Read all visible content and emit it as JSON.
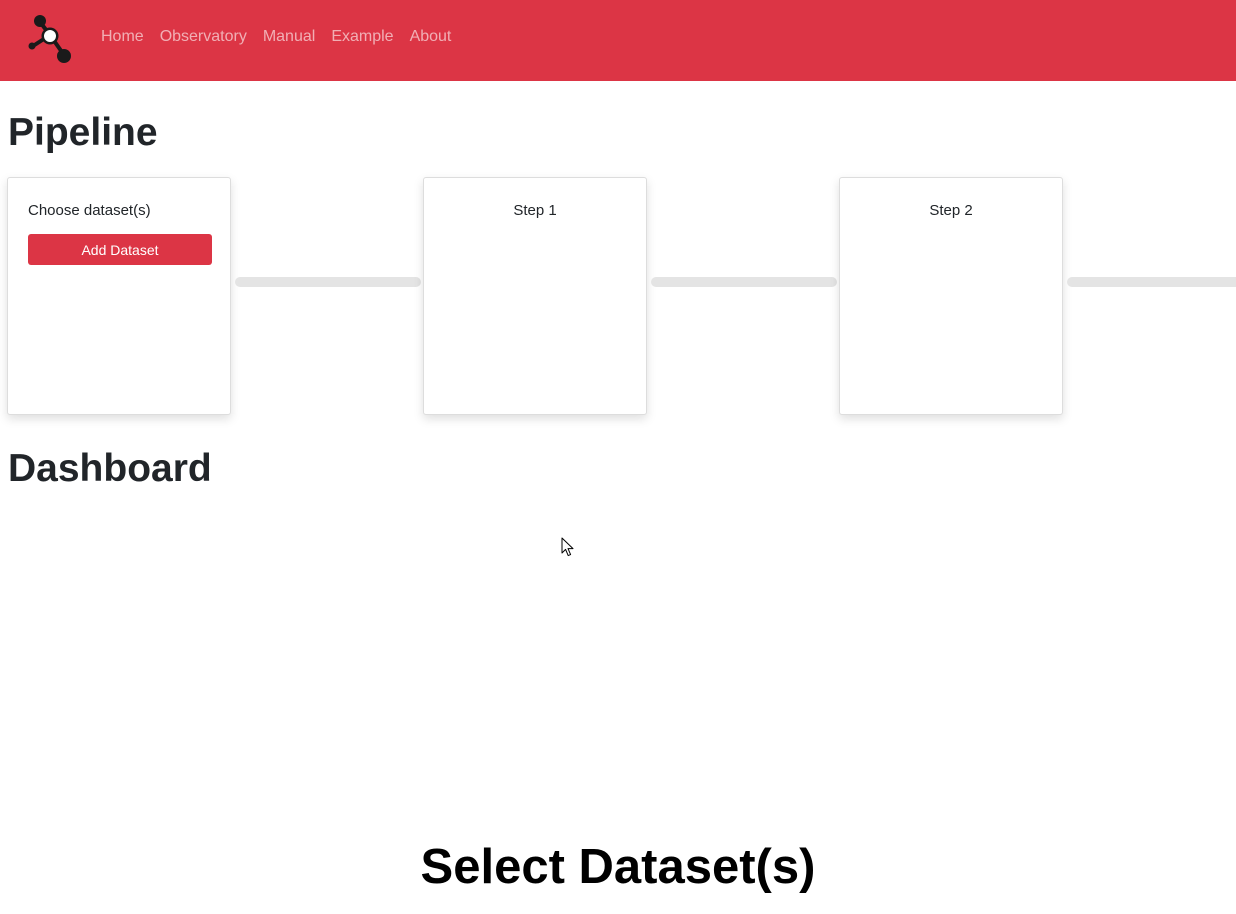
{
  "nav": {
    "links": [
      {
        "label": "Home"
      },
      {
        "label": "Observatory"
      },
      {
        "label": "Manual"
      },
      {
        "label": "Example"
      },
      {
        "label": "About"
      }
    ]
  },
  "pipeline": {
    "title": "Pipeline",
    "cards": [
      {
        "label": "Choose dataset(s)",
        "button_label": "Add Dataset"
      },
      {
        "label": "Step 1"
      },
      {
        "label": "Step 2"
      }
    ]
  },
  "dashboard": {
    "title": "Dashboard"
  },
  "caption": "Select Dataset(s)",
  "colors": {
    "accent": "#dc3545",
    "nav_link": "rgba(255,255,255,0.6)",
    "connector": "#e4e4e4"
  },
  "icons": {
    "logo": "network-graph-icon",
    "cursor": "mouse-pointer-icon"
  }
}
